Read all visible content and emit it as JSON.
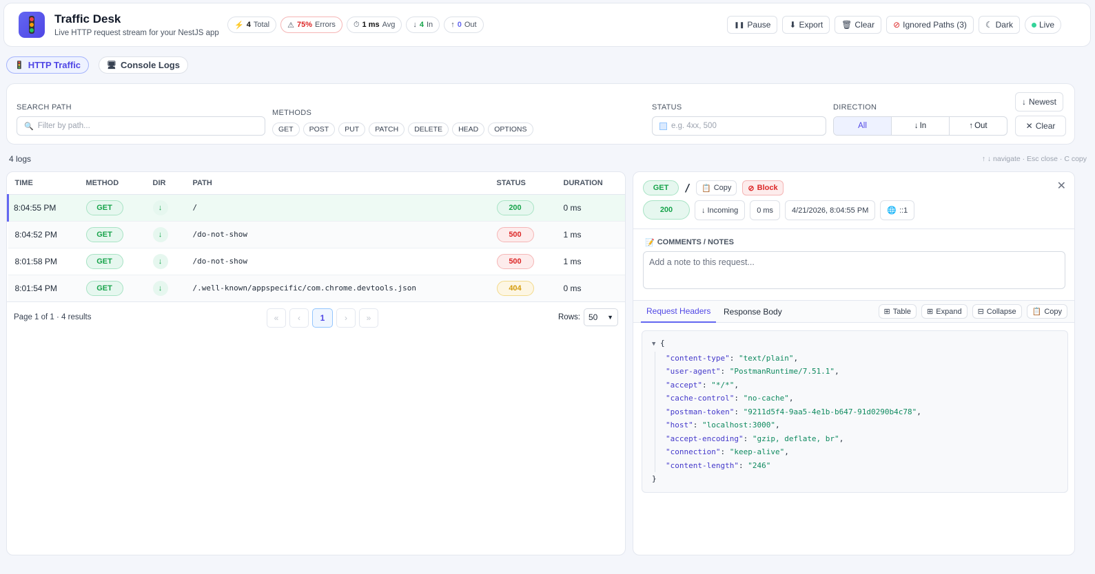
{
  "app": {
    "title": "Traffic Desk",
    "subtitle": "Live HTTP request stream for your NestJS app",
    "logo_icon": "traffic-light-icon"
  },
  "stats": {
    "total_value": "4",
    "total_label": "Total",
    "errors_value": "75%",
    "errors_label": "Errors",
    "avg_value": "1 ms",
    "avg_label": "Avg",
    "in_value": "4",
    "in_label": "In",
    "out_value": "0",
    "out_label": "Out"
  },
  "header_actions": {
    "pause": "Pause",
    "export": "Export",
    "clear": "Clear",
    "ignored": "Ignored Paths (3)",
    "dark": "Dark",
    "live": "Live"
  },
  "tabs": {
    "http": "HTTP Traffic",
    "console": "Console Logs"
  },
  "filters": {
    "search_label": "SEARCH PATH",
    "search_placeholder": "Filter by path...",
    "methods_label": "METHODS",
    "methods": [
      "GET",
      "POST",
      "PUT",
      "PATCH",
      "DELETE",
      "HEAD",
      "OPTIONS"
    ],
    "status_label": "STATUS",
    "status_placeholder": "e.g. 4xx, 500",
    "direction_label": "DIRECTION",
    "dir_all": "All",
    "dir_in": "In",
    "dir_out": "Out",
    "newest": "Newest",
    "clear": "Clear"
  },
  "list": {
    "count": "4 logs",
    "shortcuts": "↑ ↓ navigate · Esc close · C copy",
    "columns": [
      "TIME",
      "METHOD",
      "DIR",
      "PATH",
      "STATUS",
      "DURATION"
    ],
    "rows": [
      {
        "time": "8:04:55 PM",
        "method": "GET",
        "path": "/",
        "status": "200",
        "duration": "0 ms"
      },
      {
        "time": "8:04:52 PM",
        "method": "GET",
        "path": "/do-not-show",
        "status": "500",
        "duration": "1 ms"
      },
      {
        "time": "8:01:58 PM",
        "method": "GET",
        "path": "/do-not-show",
        "status": "500",
        "duration": "1 ms"
      },
      {
        "time": "8:01:54 PM",
        "method": "GET",
        "path": "/.well-known/appspecific/com.chrome.devtools.json",
        "status": "404",
        "duration": "0 ms"
      }
    ],
    "pagination": {
      "summary": "Page 1 of 1 · 4 results",
      "first": "«",
      "prev": "‹",
      "current": "1",
      "next": "›",
      "last": "»",
      "rows_label": "Rows:",
      "rows_value": "50"
    }
  },
  "detail": {
    "method": "GET",
    "path": "/",
    "copy": "Copy",
    "block": "Block",
    "status": "200",
    "direction": "↓ Incoming",
    "duration": "0 ms",
    "timestamp": "4/21/2026, 8:04:55 PM",
    "ip": "::1",
    "notes_label": "COMMENTS / NOTES",
    "notes_placeholder": "Add a note to this request...",
    "tab_request": "Request Headers",
    "tab_response": "Response Body",
    "table_btn": "Table",
    "expand_btn": "Expand",
    "collapse_btn": "Collapse",
    "copy_btn": "Copy",
    "headers": [
      {
        "key": "\"content-type\"",
        "value": "\"text/plain\""
      },
      {
        "key": "\"user-agent\"",
        "value": "\"PostmanRuntime/7.51.1\""
      },
      {
        "key": "\"accept\"",
        "value": "\"*/*\""
      },
      {
        "key": "\"cache-control\"",
        "value": "\"no-cache\""
      },
      {
        "key": "\"postman-token\"",
        "value": "\"9211d5f4-9aa5-4e1b-b647-91d0290b4c78\""
      },
      {
        "key": "\"host\"",
        "value": "\"localhost:3000\""
      },
      {
        "key": "\"accept-encoding\"",
        "value": "\"gzip, deflate, br\""
      },
      {
        "key": "\"connection\"",
        "value": "\"keep-alive\""
      },
      {
        "key": "\"content-length\"",
        "value": "\"246\""
      }
    ]
  },
  "colors": {
    "accent": "#6366f1",
    "success": "#16a34a",
    "error": "#dc2626",
    "warning": "#d49b0a"
  }
}
